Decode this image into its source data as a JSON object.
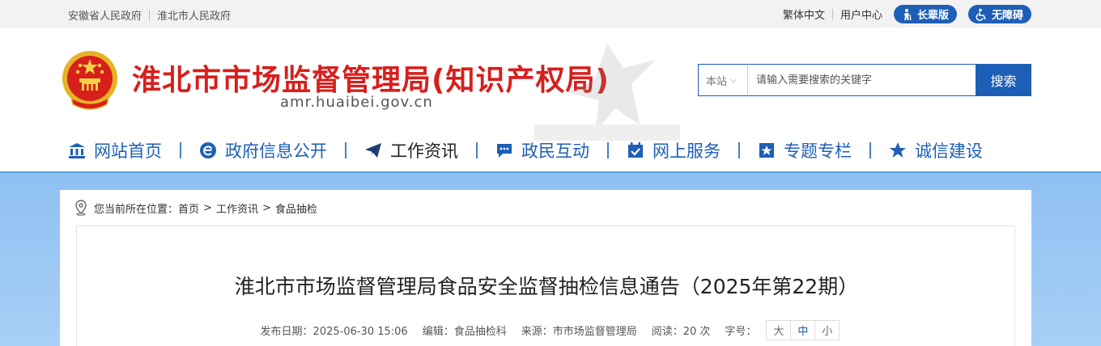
{
  "topbar": {
    "links": [
      "安徽省人民政府",
      "淮北市人民政府"
    ],
    "traditional": "繁体中文",
    "user_center": "用户中心",
    "elder_mode": "长辈版",
    "accessibility": "无障碍"
  },
  "header": {
    "site_name": "淮北市市场监督管理局(知识产权局)",
    "domain": "amr.huaibei.gov.cn"
  },
  "search": {
    "scope": "本站",
    "placeholder": "请输入需要搜索的关键字",
    "button": "搜索"
  },
  "nav": [
    {
      "label": "网站首页",
      "icon": "bank-icon"
    },
    {
      "label": "政府信息公开",
      "icon": "e-gov-icon"
    },
    {
      "label": "工作资讯",
      "icon": "paper-plane-icon"
    },
    {
      "label": "政民互动",
      "icon": "chat-icon"
    },
    {
      "label": "网上服务",
      "icon": "calendar-check-icon"
    },
    {
      "label": "专题专栏",
      "icon": "star-box-icon"
    },
    {
      "label": "诚信建设",
      "icon": "star-icon"
    }
  ],
  "breadcrumb": {
    "prefix": "您当前所在位置：",
    "items": [
      "首页",
      "工作资讯",
      "食品抽检"
    ],
    "separator": ">"
  },
  "article": {
    "title": "淮北市市场监督管理局食品安全监督抽检信息通告（2025年第22期）",
    "publish_date": "发布日期：2025-06-30 15:06",
    "editor": "编辑：食品抽检科",
    "source": "来源：市市场监督管理局",
    "reads": "阅读：20 次",
    "font_size_label": "字号：",
    "font_sizes": [
      "大",
      "中",
      "小"
    ]
  },
  "colors": {
    "brand_blue": "#1d5fb6",
    "title_red": "#d71f1c",
    "band_blue": "#8fc0f2"
  }
}
